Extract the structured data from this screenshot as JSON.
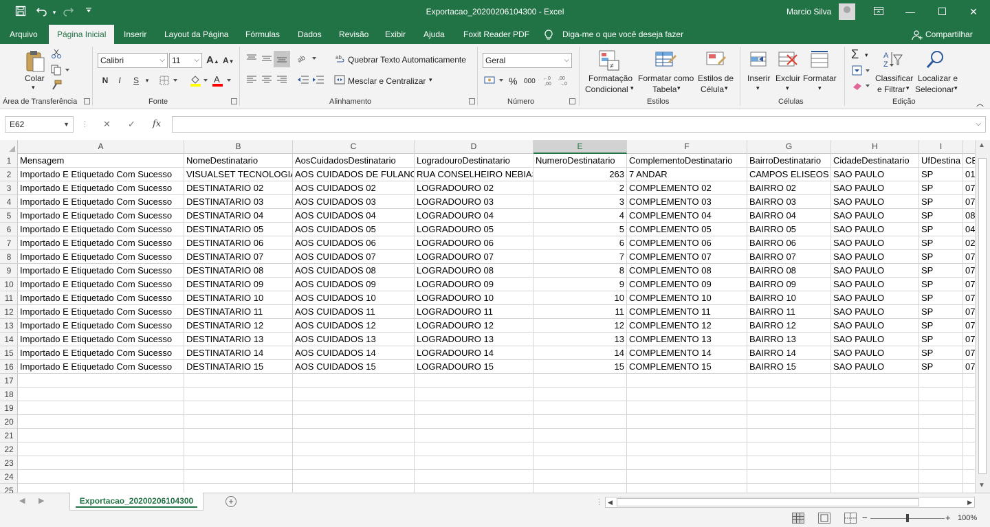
{
  "window": {
    "title": "Exportacao_20200206104300  -  Excel",
    "user": "Marcio Silva",
    "colors": {
      "brand": "#217346",
      "ribbon_bg": "#f3f3f3"
    }
  },
  "quick_access": [
    "save-icon",
    "undo-icon",
    "redo-icon",
    "customize-icon"
  ],
  "menu_tabs": [
    "Arquivo",
    "Página Inicial",
    "Inserir",
    "Layout da Página",
    "Fórmulas",
    "Dados",
    "Revisão",
    "Exibir",
    "Ajuda",
    "Foxit Reader PDF"
  ],
  "active_tab": "Página Inicial",
  "tell_me": "Diga-me o que você deseja fazer",
  "share": "Compartilhar",
  "ribbon": {
    "clipboard": {
      "label": "Área de Transferência",
      "paste": "Colar"
    },
    "font": {
      "label": "Fonte",
      "font_name": "Calibri",
      "font_size": "11",
      "bold": "N",
      "italic": "I",
      "underline": "S"
    },
    "alignment": {
      "label": "Alinhamento",
      "wrap": "Quebrar Texto Automaticamente",
      "merge": "Mesclar e Centralizar"
    },
    "number": {
      "label": "Número",
      "format": "Geral",
      "percent": "%",
      "thousands": "000"
    },
    "styles": {
      "label": "Estilos",
      "cond1": "Formatação",
      "cond2": "Condicional",
      "table1": "Formatar como",
      "table2": "Tabela",
      "cell1": "Estilos de",
      "cell2": "Célula"
    },
    "cells": {
      "label": "Células",
      "insert": "Inserir",
      "delete": "Excluir",
      "format": "Formatar"
    },
    "editing": {
      "label": "Edição",
      "sort1": "Classificar",
      "sort2": "e Filtrar",
      "find1": "Localizar e",
      "find2": "Selecionar"
    }
  },
  "formula_bar": {
    "name_box": "E62",
    "fx": "fx",
    "value": ""
  },
  "sheet": {
    "columns": [
      "A",
      "B",
      "C",
      "D",
      "E",
      "F",
      "G",
      "H",
      "I"
    ],
    "selected_column": "E",
    "row_numbers": [
      "1",
      "2",
      "3",
      "4",
      "5",
      "6",
      "7",
      "8",
      "9",
      "10",
      "11",
      "12",
      "13",
      "14",
      "15",
      "16",
      "17",
      "18",
      "19",
      "20",
      "21",
      "22",
      "23",
      "24",
      "25"
    ],
    "headers": [
      "Mensagem",
      "NomeDestinatario",
      "AosCuidadosDestinatario",
      "LogradouroDestinatario",
      "NumeroDestinatario",
      "ComplementoDestinatario",
      "BairroDestinatario",
      "CidadeDestinatario",
      "UfDestina",
      "CE"
    ],
    "rows": [
      [
        "Importado E Etiquetado Com Sucesso",
        "VISUALSET TECNOLOGIA",
        "AOS CUIDADOS DE FULANO",
        "RUA CONSELHEIRO NEBIAS",
        "263",
        "7 ANDAR",
        "CAMPOS ELISEOS",
        "SAO PAULO",
        "SP",
        "01"
      ],
      [
        "Importado E Etiquetado Com Sucesso",
        "DESTINATARIO 02",
        "AOS CUIDADOS 02",
        "LOGRADOURO 02",
        "2",
        "COMPLEMENTO 02",
        "BAIRRO 02",
        "SAO PAULO",
        "SP",
        "07"
      ],
      [
        "Importado E Etiquetado Com Sucesso",
        "DESTINATARIO 03",
        "AOS CUIDADOS 03",
        "LOGRADOURO 03",
        "3",
        "COMPLEMENTO 03",
        "BAIRRO 03",
        "SAO PAULO",
        "SP",
        "07"
      ],
      [
        "Importado E Etiquetado Com Sucesso",
        "DESTINATARIO 04",
        "AOS CUIDADOS 04",
        "LOGRADOURO 04",
        "4",
        "COMPLEMENTO 04",
        "BAIRRO 04",
        "SAO PAULO",
        "SP",
        "08"
      ],
      [
        "Importado E Etiquetado Com Sucesso",
        "DESTINATARIO 05",
        "AOS CUIDADOS 05",
        "LOGRADOURO 05",
        "5",
        "COMPLEMENTO 05",
        "BAIRRO 05",
        "SAO PAULO",
        "SP",
        "04"
      ],
      [
        "Importado E Etiquetado Com Sucesso",
        "DESTINATARIO 06",
        "AOS CUIDADOS 06",
        "LOGRADOURO 06",
        "6",
        "COMPLEMENTO 06",
        "BAIRRO 06",
        "SAO PAULO",
        "SP",
        "02"
      ],
      [
        "Importado E Etiquetado Com Sucesso",
        "DESTINATARIO 07",
        "AOS CUIDADOS 07",
        "LOGRADOURO 07",
        "7",
        "COMPLEMENTO 07",
        "BAIRRO 07",
        "SAO PAULO",
        "SP",
        "07"
      ],
      [
        "Importado E Etiquetado Com Sucesso",
        "DESTINATARIO 08",
        "AOS CUIDADOS 08",
        "LOGRADOURO 08",
        "8",
        "COMPLEMENTO 08",
        "BAIRRO 08",
        "SAO PAULO",
        "SP",
        "07"
      ],
      [
        "Importado E Etiquetado Com Sucesso",
        "DESTINATARIO 09",
        "AOS CUIDADOS 09",
        "LOGRADOURO 09",
        "9",
        "COMPLEMENTO 09",
        "BAIRRO 09",
        "SAO PAULO",
        "SP",
        "07"
      ],
      [
        "Importado E Etiquetado Com Sucesso",
        "DESTINATARIO 10",
        "AOS CUIDADOS 10",
        "LOGRADOURO 10",
        "10",
        "COMPLEMENTO 10",
        "BAIRRO 10",
        "SAO PAULO",
        "SP",
        "07"
      ],
      [
        "Importado E Etiquetado Com Sucesso",
        "DESTINATARIO 11",
        "AOS CUIDADOS 11",
        "LOGRADOURO 11",
        "11",
        "COMPLEMENTO 11",
        "BAIRRO 11",
        "SAO PAULO",
        "SP",
        "07"
      ],
      [
        "Importado E Etiquetado Com Sucesso",
        "DESTINATARIO 12",
        "AOS CUIDADOS 12",
        "LOGRADOURO 12",
        "12",
        "COMPLEMENTO 12",
        "BAIRRO 12",
        "SAO PAULO",
        "SP",
        "07"
      ],
      [
        "Importado E Etiquetado Com Sucesso",
        "DESTINATARIO 13",
        "AOS CUIDADOS 13",
        "LOGRADOURO 13",
        "13",
        "COMPLEMENTO 13",
        "BAIRRO 13",
        "SAO PAULO",
        "SP",
        "07"
      ],
      [
        "Importado E Etiquetado Com Sucesso",
        "DESTINATARIO 14",
        "AOS CUIDADOS 14",
        "LOGRADOURO 14",
        "14",
        "COMPLEMENTO 14",
        "BAIRRO 14",
        "SAO PAULO",
        "SP",
        "07"
      ],
      [
        "Importado E Etiquetado Com Sucesso",
        "DESTINATARIO 15",
        "AOS CUIDADOS 15",
        "LOGRADOURO 15",
        "15",
        "COMPLEMENTO 15",
        "BAIRRO 15",
        "SAO PAULO",
        "SP",
        "07"
      ]
    ],
    "tab_name": "Exportacao_20200206104300"
  },
  "status": {
    "zoom": "100%"
  }
}
